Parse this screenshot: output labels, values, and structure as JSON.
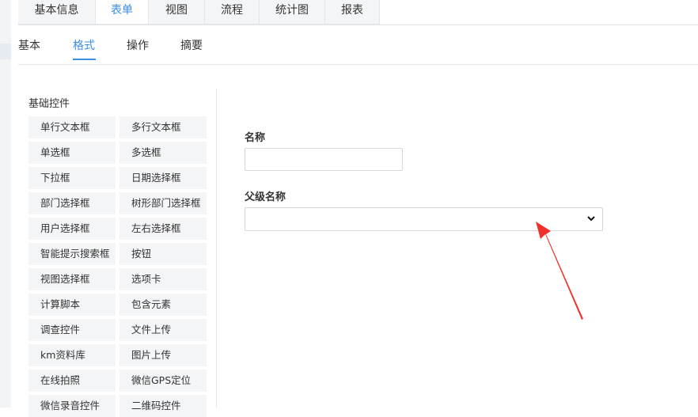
{
  "top_tabs": [
    {
      "label": "基本信息",
      "active": false
    },
    {
      "label": "表单",
      "active": true
    },
    {
      "label": "视图",
      "active": false
    },
    {
      "label": "流程",
      "active": false
    },
    {
      "label": "统计图",
      "active": false
    },
    {
      "label": "报表",
      "active": false
    }
  ],
  "sub_tabs": [
    {
      "label": "基本",
      "active": false
    },
    {
      "label": "格式",
      "active": true
    },
    {
      "label": "操作",
      "active": false
    },
    {
      "label": "摘要",
      "active": false
    }
  ],
  "palette": {
    "title": "基础控件",
    "controls": [
      "单行文本框",
      "多行文本框",
      "单选框",
      "多选框",
      "下拉框",
      "日期选择框",
      "部门选择框",
      "树形部门选择框",
      "用户选择框",
      "左右选择框",
      "智能提示搜索框",
      "按钮",
      "视图选择框",
      "选项卡",
      "计算脚本",
      "包含元素",
      "调查控件",
      "文件上传",
      "km资料库",
      "图片上传",
      "在线拍照",
      "微信GPS定位",
      "微信录音控件",
      "二维码控件"
    ]
  },
  "form": {
    "name_label": "名称",
    "name_value": "",
    "parent_label": "父级名称",
    "parent_value": ""
  },
  "colors": {
    "accent": "#3a8ee6",
    "annotation_arrow": "#f0302a"
  },
  "icons": {
    "select_chevron": "chevron-down-icon",
    "annotation": "red-arrow-icon"
  }
}
